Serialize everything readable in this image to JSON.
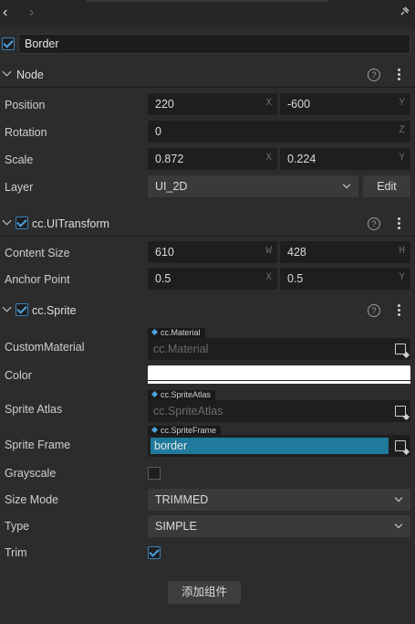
{
  "node": {
    "enabled": true,
    "name": "Border"
  },
  "sections": {
    "node": {
      "title": "Node",
      "position": {
        "label": "Position",
        "x": "220",
        "y": "-600"
      },
      "rotation": {
        "label": "Rotation",
        "z": "0"
      },
      "scale": {
        "label": "Scale",
        "x": "0.872",
        "y": "0.224"
      },
      "layer": {
        "label": "Layer",
        "value": "UI_2D",
        "edit_label": "Edit"
      }
    },
    "uitransform": {
      "title": "cc.UITransform",
      "content_size": {
        "label": "Content Size",
        "w": "610",
        "h": "428"
      },
      "anchor_point": {
        "label": "Anchor Point",
        "x": "0.5",
        "y": "0.5"
      }
    },
    "sprite": {
      "title": "cc.Sprite",
      "custom_material": {
        "label": "CustomMaterial",
        "tag": "cc.Material",
        "placeholder": "cc.Material"
      },
      "color": {
        "label": "Color",
        "value": "#ffffff"
      },
      "sprite_atlas": {
        "label": "Sprite Atlas",
        "tag": "cc.SpriteAtlas",
        "placeholder": "cc.SpriteAtlas"
      },
      "sprite_frame": {
        "label": "Sprite Frame",
        "tag": "cc.SpriteFrame",
        "value": "border"
      },
      "grayscale": {
        "label": "Grayscale",
        "checked": false
      },
      "size_mode": {
        "label": "Size Mode",
        "value": "TRIMMED"
      },
      "type": {
        "label": "Type",
        "value": "SIMPLE"
      },
      "trim": {
        "label": "Trim",
        "checked": true
      }
    }
  },
  "axes": {
    "x": "X",
    "y": "Y",
    "z": "Z",
    "w": "W",
    "h": "H"
  },
  "help_glyph": "?",
  "add_component_label": "添加组件",
  "icons": [
    "back-arrow-icon",
    "forward-arrow-icon",
    "pin-icon",
    "help-icon",
    "kebab-menu-icon",
    "chevron-down-icon",
    "asset-picker-icon"
  ]
}
